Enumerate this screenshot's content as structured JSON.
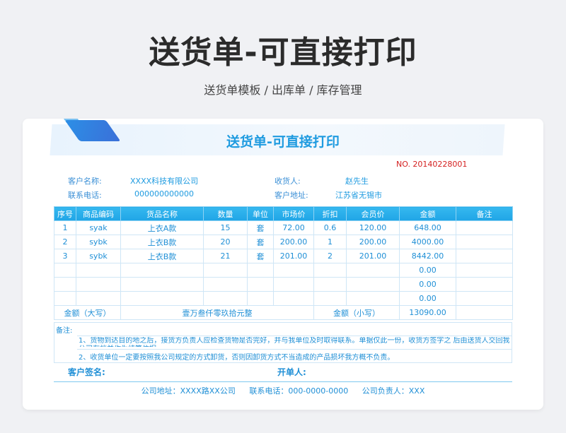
{
  "hero": {
    "title": "送货单-可直接打印",
    "subtitle": "送货单模板 / 出库单 / 库存管理"
  },
  "doc": {
    "title": "送货单-可直接打印",
    "number": "NO. 20140228001"
  },
  "info": {
    "customer_name_label": "客户名称:",
    "customer_name": "XXXX科技有限公司",
    "phone_label": "联系电话:",
    "phone": "000000000000",
    "receiver_label": "收货人:",
    "receiver": "赵先生",
    "address_label": "客户地址:",
    "address": "江苏省无锡市"
  },
  "table": {
    "headers": [
      "序号",
      "商品编码",
      "货品名称",
      "数量",
      "单位",
      "市场价",
      "折扣",
      "会员价",
      "金额",
      "备注"
    ],
    "rows": [
      [
        "1",
        "syak",
        "上衣A款",
        "15",
        "套",
        "72.00",
        "0.6",
        "120.00",
        "648.00",
        ""
      ],
      [
        "2",
        "sybk",
        "上衣B款",
        "20",
        "套",
        "200.00",
        "1",
        "200.00",
        "4000.00",
        ""
      ],
      [
        "3",
        "sybk",
        "上衣B款",
        "21",
        "套",
        "201.00",
        "2",
        "201.00",
        "8442.00",
        ""
      ],
      [
        "",
        "",
        "",
        "",
        "",
        "",
        "",
        "",
        "0.00",
        ""
      ],
      [
        "",
        "",
        "",
        "",
        "",
        "",
        "",
        "",
        "0.00",
        ""
      ],
      [
        "",
        "",
        "",
        "",
        "",
        "",
        "",
        "",
        "0.00",
        ""
      ]
    ],
    "total_upper_label": "金额（大写）",
    "total_upper": "壹万叁仟零玖拾元整",
    "total_lower_label": "金额（小写）",
    "total_lower": "13090.00"
  },
  "notes": {
    "label": "备注:",
    "line1": "1、货物到达目的地之后，接货方负责人应检查货物是否完好，并与我单位及时取得联系。单据仅此一份，收货方签字之 后由送货人交回我公司存档并作为结算依据。",
    "line2": "2、收货单位一定要按照我公司规定的方式卸货，否则因卸货方式不当造成的产品损坏我方概不负责。"
  },
  "sign": {
    "customer": "客户签名:",
    "issuer": "开单人:"
  },
  "footer": {
    "address": "公司地址：XXXX路XX公司",
    "phone": "联系电话：000-0000-0000",
    "manager": "公司负责人：XXX"
  }
}
